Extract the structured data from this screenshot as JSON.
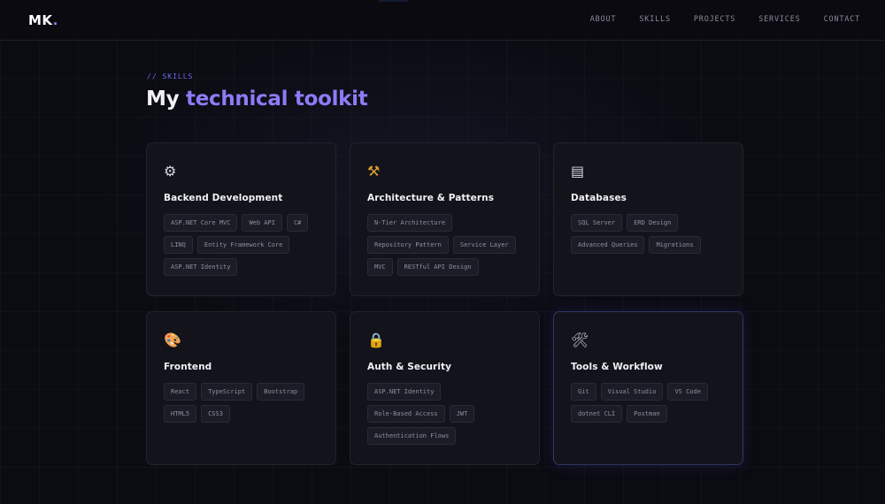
{
  "header": {
    "logo_text": "MK",
    "logo_dot": ".",
    "nav": [
      "ABOUT",
      "SKILLS",
      "PROJECTS",
      "SERVICES",
      "CONTACT"
    ]
  },
  "section": {
    "tag": "// SKILLS",
    "title_plain": "My ",
    "title_accent": "technical toolkit"
  },
  "cards": [
    {
      "icon": "⚙",
      "icon_name": "gear-icon",
      "title": "Backend Development",
      "tags": [
        "ASP.NET Core MVC",
        "Web API",
        "C#",
        "LINQ",
        "Entity Framework Core",
        "ASP.NET Identity"
      ]
    },
    {
      "icon": "⚒",
      "icon_name": "hammer-and-pick-icon",
      "title": "Architecture & Patterns",
      "tags": [
        "N-Tier Architecture",
        "Repository Pattern",
        "Service Layer",
        "MVC",
        "RESTful API Design"
      ]
    },
    {
      "icon": "▤",
      "icon_name": "file-cabinet-icon",
      "title": "Databases",
      "tags": [
        "SQL Server",
        "ERD Design",
        "Advanced Queries",
        "Migrations"
      ]
    },
    {
      "icon": "🎨",
      "icon_name": "palette-icon",
      "title": "Frontend",
      "tags": [
        "React",
        "TypeScript",
        "Bootstrap",
        "HTML5",
        "CSS3"
      ]
    },
    {
      "icon": "🔒",
      "icon_name": "lock-icon",
      "title": "Auth & Security",
      "tags": [
        "ASP.NET Identity",
        "Role-Based Access",
        "JWT",
        "Authentication Flows"
      ]
    },
    {
      "icon": "🛠",
      "icon_name": "tools-icon",
      "title": "Tools & Workflow",
      "tags": [
        "Git",
        "Visual Studio",
        "VS Code",
        "dotnet CLI",
        "Postman"
      ]
    }
  ],
  "colors": {
    "accent": "#8b7cf6",
    "tag_accent": "#6c6cf2",
    "background": "#0b0b12",
    "card": "#13131c"
  }
}
